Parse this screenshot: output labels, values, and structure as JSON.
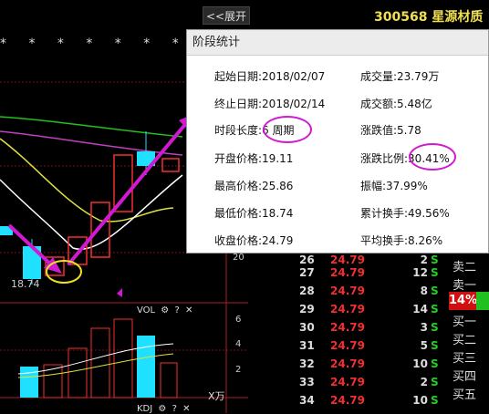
{
  "toolbar": {
    "expand_label": "<<展开"
  },
  "stock": {
    "title": "300568 星源材质"
  },
  "chart": {
    "stars": "* * * * * * * *",
    "price_label": "18.74",
    "vol_title": "VOL",
    "kdj_title": "KDJ",
    "vol_ticks": [
      "6",
      "4",
      "2"
    ],
    "unit_label": "X万",
    "axis_ticks": [
      "20"
    ]
  },
  "popup": {
    "title": "阶段统计",
    "rows": [
      {
        "left": "起始日期:2018/02/07",
        "right": "成交量:23.79万"
      },
      {
        "left": "终止日期:2018/02/14",
        "right": "成交额:5.48亿"
      },
      {
        "left": "时段长度:6 周期",
        "right": "涨跌值:5.78"
      },
      {
        "left": "开盘价格:19.11",
        "right": "涨跌比例:30.41%"
      },
      {
        "left": "最高价格:25.86",
        "right": "振幅:37.99%"
      },
      {
        "left": "最低价格:18.74",
        "right": "累计换手:49.56%"
      },
      {
        "left": "收盘价格:24.79",
        "right": "平均换手:8.26%"
      }
    ]
  },
  "quotes": {
    "rows": [
      {
        "min": "26",
        "price": "24.79",
        "qty": "2",
        "dir": "S"
      },
      {
        "min": "27",
        "price": "24.79",
        "qty": "12",
        "dir": "S"
      },
      {
        "min": "28",
        "price": "24.79",
        "qty": "8",
        "dir": "S"
      },
      {
        "min": "29",
        "price": "24.79",
        "qty": "14",
        "dir": "S"
      },
      {
        "min": "30",
        "price": "24.79",
        "qty": "3",
        "dir": "S"
      },
      {
        "min": "31",
        "price": "24.79",
        "qty": "5",
        "dir": "S"
      },
      {
        "min": "32",
        "price": "24.79",
        "qty": "10",
        "dir": "S"
      },
      {
        "min": "33",
        "price": "24.79",
        "qty": "2",
        "dir": "S"
      },
      {
        "min": "34",
        "price": "24.79",
        "qty": "10",
        "dir": "S"
      }
    ],
    "side_labels": [
      "卖二",
      "卖一",
      "买一",
      "买二",
      "买三",
      "买四",
      "买五"
    ],
    "pct_badge": "14%"
  },
  "colors": {
    "accent_magenta": "#d01ad0",
    "price_red": "#f03030",
    "sell_green": "#20d020",
    "title_yellow": "#f0e050"
  }
}
